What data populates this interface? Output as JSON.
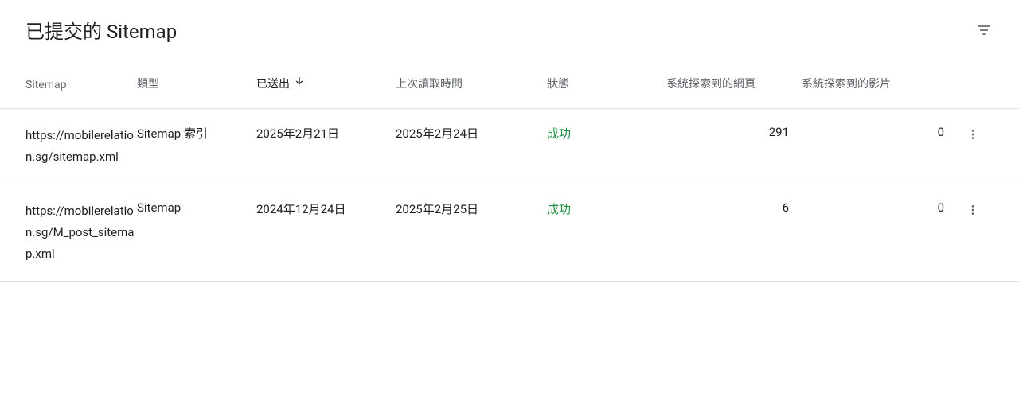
{
  "header": {
    "title": "已提交的 Sitemap"
  },
  "columns": {
    "sitemap": "Sitemap",
    "type": "類型",
    "submitted": "已送出",
    "lastread": "上次讀取時間",
    "status": "狀態",
    "pages": "系統探索到的網頁",
    "videos": "系統探索到的影片"
  },
  "rows": [
    {
      "sitemap": "https://mobilerelation.sg/sitemap.xml",
      "type": "Sitemap 索引",
      "submitted": "2025年2月21日",
      "lastread": "2025年2月24日",
      "status": "成功",
      "pages": "291",
      "videos": "0"
    },
    {
      "sitemap": "https://mobilerelation.sg/M_post_sitemap.xml",
      "type": "Sitemap",
      "submitted": "2024年12月24日",
      "lastread": "2025年2月25日",
      "status": "成功",
      "pages": "6",
      "videos": "0"
    }
  ]
}
